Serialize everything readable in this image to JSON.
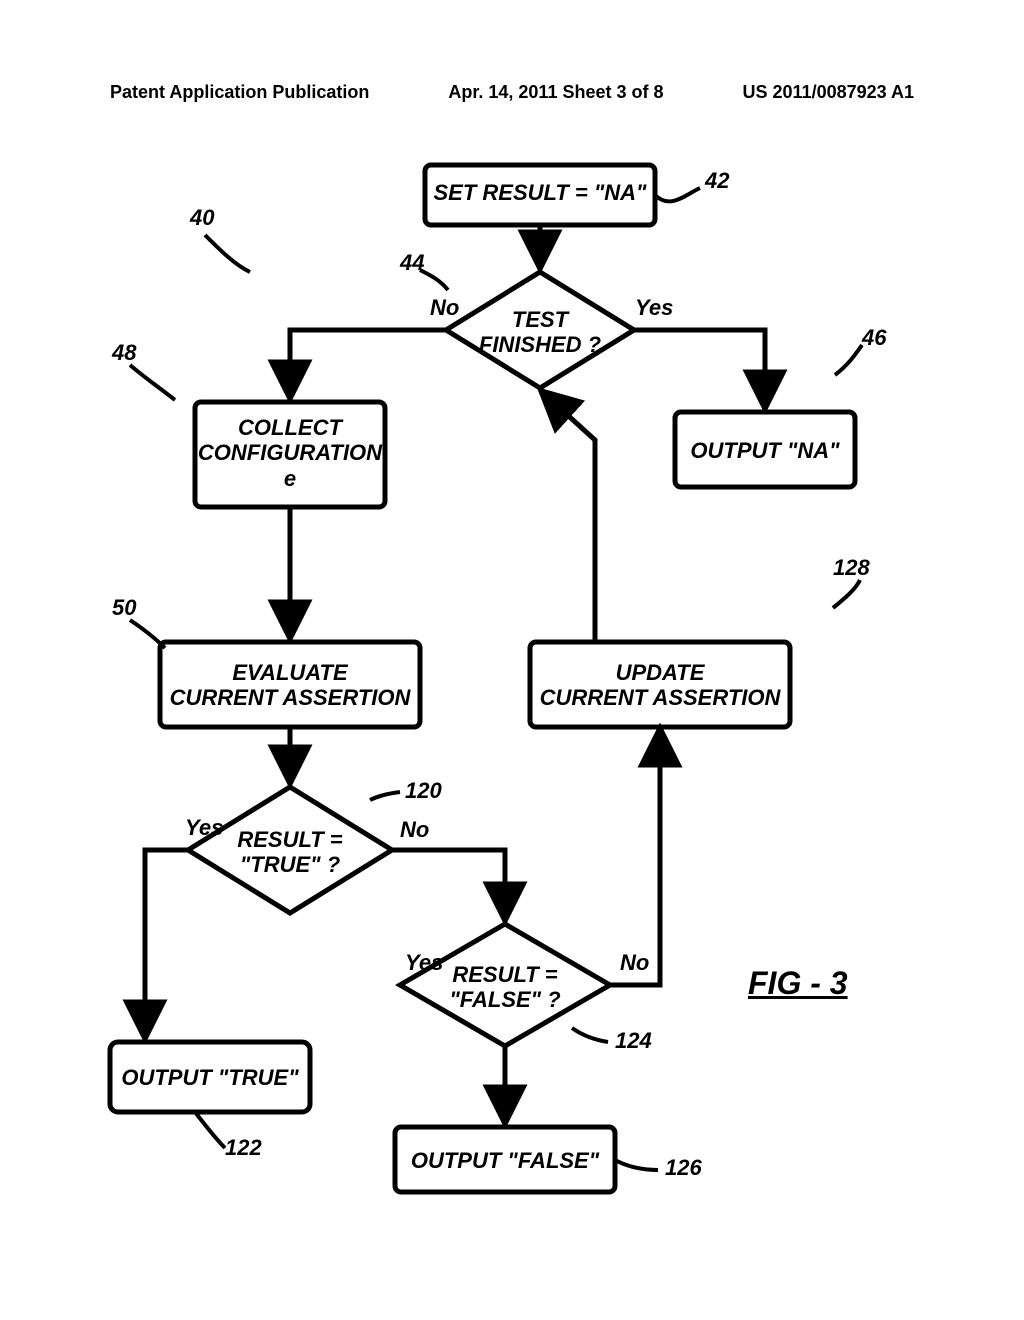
{
  "header": {
    "left": "Patent Application Publication",
    "mid": "Apr. 14, 2011  Sheet 3 of 8",
    "right": "US 2011/0087923 A1"
  },
  "figure_label": "FIG - 3",
  "refs": {
    "r40": "40",
    "r42": "42",
    "r44": "44",
    "r46": "46",
    "r48": "48",
    "r50": "50",
    "r120": "120",
    "r122": "122",
    "r124": "124",
    "r126": "126",
    "r128": "128"
  },
  "nodes": {
    "n42": "SET RESULT = \"NA\"",
    "n44": "TEST\nFINISHED ?",
    "n46": "OUTPUT \"NA\"",
    "n48": "COLLECT\nCONFIGURATION\ne",
    "n50": "EVALUATE\nCURRENT ASSERTION",
    "n120": "RESULT =\n\"TRUE\" ?",
    "n122": "OUTPUT \"TRUE\"",
    "n124": "RESULT =\n\"FALSE\" ?",
    "n126": "OUTPUT \"FALSE\"",
    "n128": "UPDATE\nCURRENT ASSERTION"
  },
  "edges": {
    "no": "No",
    "yes": "Yes"
  }
}
